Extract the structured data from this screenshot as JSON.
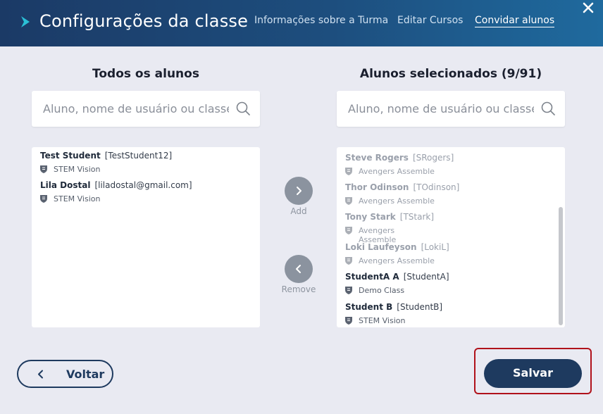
{
  "header": {
    "title": "Configurações da classe",
    "nav": [
      {
        "label": "Informações sobre a Turma",
        "active": false
      },
      {
        "label": "Editar Cursos",
        "active": false
      },
      {
        "label": "Convidar alunos",
        "active": true
      }
    ]
  },
  "left_panel": {
    "title": "Todos os alunos",
    "search_placeholder": "Aluno, nome de usuário ou classe",
    "students": [
      {
        "name": "Test Student",
        "username": "[TestStudent12]",
        "class": "STEM Vision"
      },
      {
        "name": "Lila Dostal",
        "username": "[liladostal@gmail.com]",
        "class": "STEM Vision"
      }
    ]
  },
  "right_panel": {
    "title": "Alunos selecionados (9/91)",
    "search_placeholder": "Aluno, nome de usuário ou classe",
    "students": [
      {
        "name": "Steve Rogers",
        "username": "[SRogers]",
        "class": "Avengers Assemble",
        "dimmed": true
      },
      {
        "name": "Thor Odinson",
        "username": "[TOdinson]",
        "class": "Avengers Assemble",
        "dimmed": true
      },
      {
        "name": "Tony Stark",
        "username": "[TStark]",
        "class": "Avengers Assemble",
        "dimmed": true
      },
      {
        "name": "Loki Laufeyson",
        "username": "[LokiL]",
        "class": "Avengers Assemble",
        "dimmed": true
      },
      {
        "name": "StudentA A",
        "username": "[StudentA]",
        "class": "Demo Class",
        "dimmed": false
      },
      {
        "name": "Student B",
        "username": "[StudentB]",
        "class": "STEM Vision",
        "dimmed": false
      }
    ]
  },
  "actions": {
    "add_label": "Add",
    "remove_label": "Remove",
    "back_label": "Voltar",
    "save_label": "Salvar"
  },
  "icons": {
    "logo": "chevron-right-icon",
    "close": "close-icon",
    "search": "search-icon",
    "class": "shield-icon",
    "add": "chevron-right-icon",
    "remove": "chevron-left-icon",
    "back": "chevron-left-icon"
  },
  "colors": {
    "accent": "#2bb3c9",
    "primary": "#1e3a5f",
    "highlight": "#b0121b"
  }
}
